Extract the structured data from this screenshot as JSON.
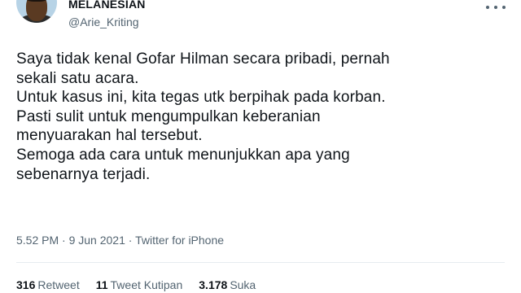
{
  "user": {
    "display_name": "MELANESIAN",
    "handle": "@Arie_Kriting"
  },
  "tweet": {
    "lines": [
      "Saya tidak kenal Gofar Hilman secara pribadi, pernah",
      "sekali satu acara.",
      "Untuk kasus ini, kita tegas utk berpihak pada korban.",
      "Pasti sulit untuk mengumpulkan keberanian",
      "menyuarakan hal tersebut.",
      "Semoga ada cara untuk menunjukkan apa yang",
      "sebenarnya terjadi."
    ],
    "time": "5.52 PM",
    "date": "9 Jun 2021",
    "source": "Twitter for iPhone"
  },
  "stats": {
    "retweets_count": "316",
    "retweets_label": "Retweet",
    "quotes_count": "11",
    "quotes_label": "Tweet Kutipan",
    "likes_count": "3.178",
    "likes_label": "Suka"
  },
  "icons": {
    "more": "more-horizontal-icon"
  }
}
